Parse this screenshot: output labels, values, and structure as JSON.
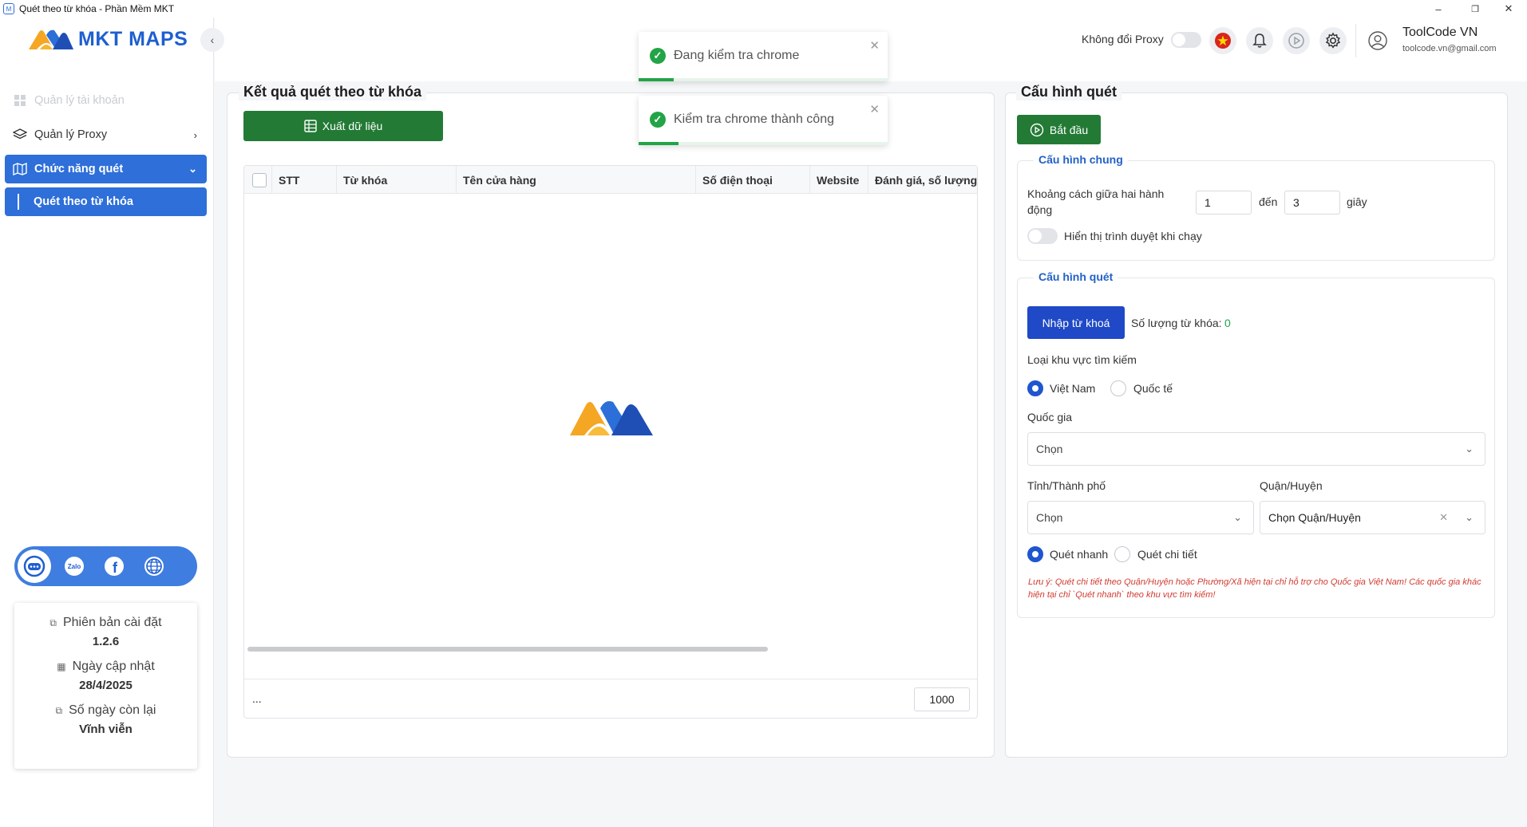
{
  "window": {
    "title": "Quét theo từ khóa - Phần Mềm MKT",
    "minimize": "–",
    "restore": "❐",
    "close": "✕"
  },
  "logo": {
    "text": "MKT MAPS"
  },
  "sidebar": {
    "items": [
      {
        "label": "Quản lý tài khoản"
      },
      {
        "label": "Quản lý Proxy"
      },
      {
        "label": "Chức năng quét"
      },
      {
        "label": "Quét theo từ khóa"
      }
    ]
  },
  "info": {
    "version_label": "Phiên bản cài đặt",
    "version_value": "1.2.6",
    "updated_label": "Ngày cập nhật",
    "updated_value": "28/4/2025",
    "days_label": "Số ngày còn lại",
    "days_value": "Vĩnh viễn"
  },
  "header": {
    "proxy_label": "Không đổi Proxy",
    "user_name": "ToolCode VN",
    "user_email": "toolcode.vn@gmail.com"
  },
  "toasts": [
    {
      "message": "Đang kiểm tra chrome",
      "progress": 0.14
    },
    {
      "message": "Kiểm tra chrome thành công",
      "progress": 0.16
    }
  ],
  "results": {
    "title": "Kết quả quét theo từ khóa",
    "export_label": "Xuất dữ liệu",
    "columns": [
      "STT",
      "Từ khóa",
      "Tên cửa hàng",
      "Số điện thoại",
      "Website",
      "Đánh giá, số lượng"
    ],
    "footer_ellipsis": "...",
    "page_size": "1000"
  },
  "config": {
    "title": "Cấu hình quét",
    "start_label": "Bắt đầu",
    "general": {
      "title": "Cấu hình chung",
      "interval_label_1": "Khoảng cách giữa hai hành",
      "interval_label_2": "động",
      "from_value": "1",
      "to_label": "đến",
      "to_value": "3",
      "unit": "giây",
      "show_browser_label": "Hiển thị trình duyệt khi chạy"
    },
    "scan": {
      "title": "Cấu hình quét",
      "import_label": "Nhập từ khoá",
      "count_label": "Số lượng từ khóa:",
      "count_value": "0",
      "region_label": "Loại khu vực tìm kiếm",
      "region_options": [
        "Việt Nam",
        "Quốc tế"
      ],
      "country_label": "Quốc gia",
      "country_value": "Chọn",
      "province_label": "Tỉnh/Thành phố",
      "province_value": "Chọn",
      "district_label": "Quận/Huyện",
      "district_value": "Chọn Quận/Huyện",
      "mode_options": [
        "Quét nhanh",
        "Quét chi tiết"
      ],
      "note": "Lưu ý: Quét chi tiết theo Quận/Huyện hoặc Phường/Xã hiện tại chỉ hỗ trợ cho Quốc gia Việt Nam! Các quốc gia khác hiện tại chỉ `Quét nhanh` theo khu vực tìm kiếm!"
    }
  },
  "colors": {
    "primary": "#2e6fd9",
    "green": "#237a35",
    "success": "#22a447",
    "accent_orange": "#f5a623"
  }
}
